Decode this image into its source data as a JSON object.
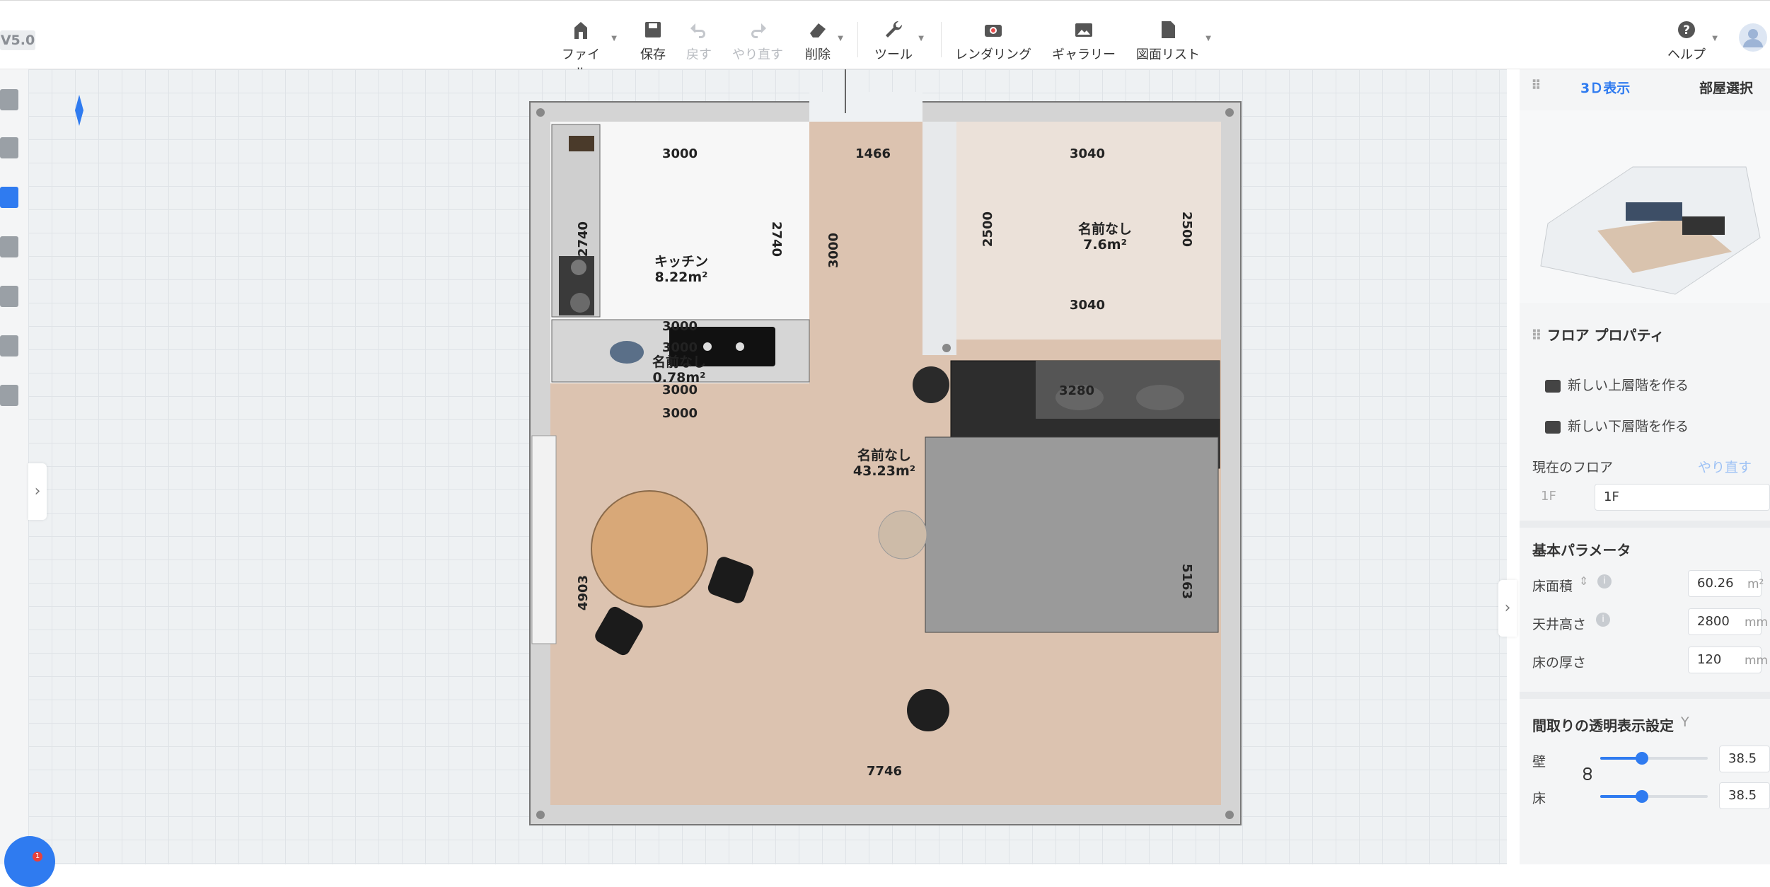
{
  "app": {
    "version": "V5.0"
  },
  "toolbar": {
    "file": "ファイル",
    "save": "保存",
    "undo": "戻す",
    "redo": "やり直す",
    "delete": "削除",
    "tools": "ツール",
    "render": "レンダリング",
    "gallery": "ギャラリー",
    "drawings": "図面リスト",
    "help": "ヘルプ"
  },
  "plan": {
    "rooms": [
      {
        "name": "キッチン",
        "area": "8.22m²"
      },
      {
        "name": "名前なし",
        "area": "7.6m²"
      },
      {
        "name": "名前なし",
        "area": "0.78m²"
      },
      {
        "name": "名前なし",
        "area": "43.23m²"
      }
    ],
    "dimensions": [
      "3000",
      "1466",
      "3040",
      "2740",
      "2740",
      "3000",
      "2500",
      "2500",
      "3040",
      "3000",
      "3000",
      "3000",
      "3000",
      "3280",
      "4903",
      "5163",
      "7746"
    ]
  },
  "panel": {
    "tabs": {
      "view3d": "3Ｄ表示",
      "room_select": "部屋選択"
    },
    "floor_props": {
      "title": "フロア プロパティ",
      "new_upper": "新しい上層階を作る",
      "new_lower": "新しい下層階を作る",
      "current_floor_label": "現在のフロア",
      "redo_label": "やり直す",
      "floor_select": "1F",
      "floor_name": "1F"
    },
    "basic_params": {
      "title": "基本パラメータ",
      "floor_area_label": "床面積",
      "floor_area_value": "60.26",
      "floor_area_unit": "m²",
      "ceiling_label": "天井高さ",
      "ceiling_value": "2800",
      "ceiling_unit": "mm",
      "thickness_label": "床の厚さ",
      "thickness_value": "120",
      "thickness_unit": "mm"
    },
    "transparency": {
      "title": "間取りの透明表示設定",
      "shortcut": "Y",
      "wall_label": "壁",
      "wall_value": "38.5",
      "wall_level": 0.385,
      "floor_label": "床",
      "floor_value": "38.5",
      "floor_level": 0.385,
      "unit": "%"
    }
  },
  "colors": {
    "accent": "#2f7bf0",
    "floor": "#dcc3b0",
    "wall": "#d4d4d4"
  }
}
